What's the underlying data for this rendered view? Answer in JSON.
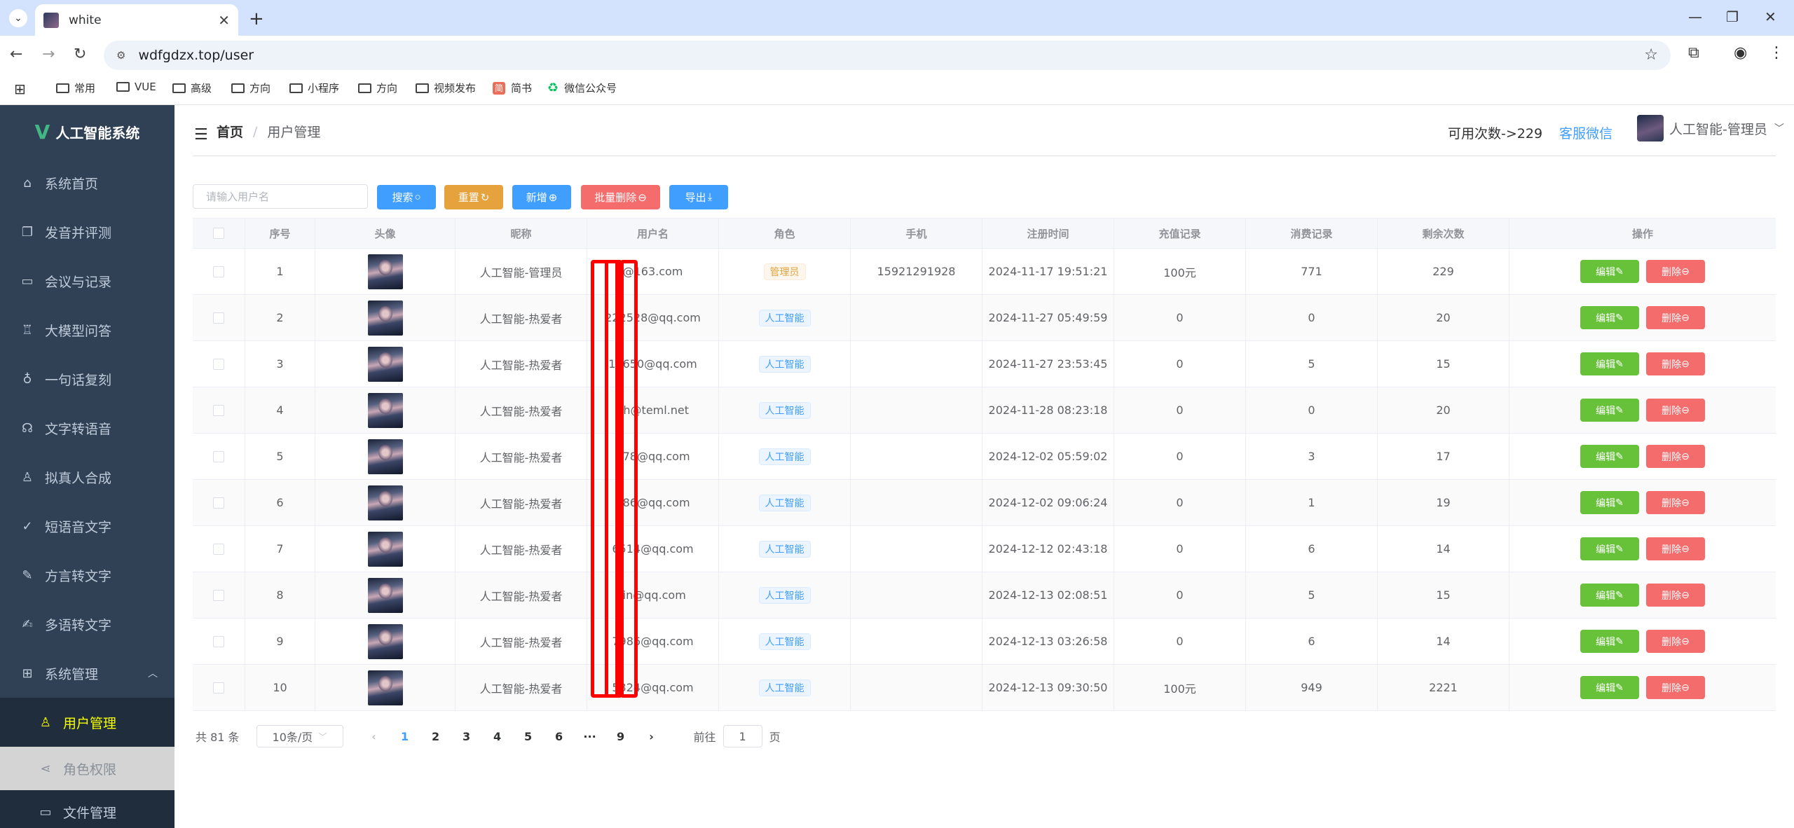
{
  "browser": {
    "tab_title": "white",
    "url": "wdfgdzx.top/user",
    "bookmarks": [
      "常用",
      "VUE",
      "高级",
      "方向",
      "小程序",
      "方向",
      "视频发布",
      "简书",
      "微信公众号"
    ]
  },
  "sidebar": {
    "logo": "人工智能系统",
    "items": [
      {
        "label": "系统首页",
        "icon": "home-icon"
      },
      {
        "label": "发音并评测",
        "icon": "book-icon"
      },
      {
        "label": "会议与记录",
        "icon": "monitor-icon"
      },
      {
        "label": "大模型问答",
        "icon": "cup-icon"
      },
      {
        "label": "一句话复刻",
        "icon": "microphone-icon"
      },
      {
        "label": "文字转语音",
        "icon": "headset-icon"
      },
      {
        "label": "拟真人合成",
        "icon": "user-icon"
      },
      {
        "label": "短语音文字",
        "icon": "sign-icon"
      },
      {
        "label": "方言转文字",
        "icon": "pen-icon"
      },
      {
        "label": "多语转文字",
        "icon": "edit-icon"
      },
      {
        "label": "系统管理",
        "icon": "menu-icon"
      }
    ],
    "sub_items": [
      {
        "label": "用户管理",
        "icon": "user-icon",
        "active": true
      },
      {
        "label": "角色权限",
        "icon": "share-icon"
      },
      {
        "label": "文件管理",
        "icon": "folder-icon"
      }
    ]
  },
  "header": {
    "breadcrumb_home": "首页",
    "breadcrumb_separator": "/",
    "breadcrumb_current": "用户管理",
    "available_count": "可用次数->229",
    "service_link": "客服微信",
    "user_name": "人工智能-管理员"
  },
  "toolbar": {
    "search_placeholder": "请输入用户名",
    "search_btn": "搜索",
    "reset_btn": "重置",
    "add_btn": "新增",
    "batch_delete_btn": "批量删除",
    "export_btn": "导出",
    "colors": {
      "primary": "#409eff",
      "warning": "#e6a23c",
      "danger": "#f56c6c",
      "success": "#67c23a"
    }
  },
  "table": {
    "columns": [
      "序号",
      "头像",
      "昵称",
      "用户名",
      "角色",
      "手机",
      "注册时间",
      "充值记录",
      "消费记录",
      "剩余次数",
      "操作"
    ],
    "edit_label": "编辑",
    "delete_label": "删除",
    "rows": [
      {
        "id": "1",
        "nickname": "人工智能-管理员",
        "username": "@163.com",
        "role": "管理员",
        "role_type": "admin",
        "phone": "15921291928",
        "reg_time": "2024-11-17 19:51:21",
        "recharge": "100元",
        "consume": "771",
        "remaining": "229"
      },
      {
        "id": "2",
        "nickname": "人工智能-热爱者",
        "username": "222528@qq.com",
        "role": "人工智能",
        "role_type": "ai",
        "phone": "",
        "reg_time": "2024-11-27 05:49:59",
        "recharge": "0",
        "consume": "0",
        "remaining": "20"
      },
      {
        "id": "3",
        "nickname": "人工智能-热爱者",
        "username": "17650@qq.com",
        "role": "人工智能",
        "role_type": "ai",
        "phone": "",
        "reg_time": "2024-11-27 23:53:45",
        "recharge": "0",
        "consume": "5",
        "remaining": "15"
      },
      {
        "id": "4",
        "nickname": "人工智能-热爱者",
        "username": "yh@teml.net",
        "role": "人工智能",
        "role_type": "ai",
        "phone": "",
        "reg_time": "2024-11-28 08:23:18",
        "recharge": "0",
        "consume": "0",
        "remaining": "20"
      },
      {
        "id": "5",
        "nickname": "人工智能-热爱者",
        "username": "978@qq.com",
        "role": "人工智能",
        "role_type": "ai",
        "phone": "",
        "reg_time": "2024-12-02 05:59:02",
        "recharge": "0",
        "consume": "3",
        "remaining": "17"
      },
      {
        "id": "6",
        "nickname": "人工智能-热爱者",
        "username": "986@qq.com",
        "role": "人工智能",
        "role_type": "ai",
        "phone": "",
        "reg_time": "2024-12-02 09:06:24",
        "recharge": "0",
        "consume": "1",
        "remaining": "19"
      },
      {
        "id": "7",
        "nickname": "人工智能-热爱者",
        "username": "6514@qq.com",
        "role": "人工智能",
        "role_type": "ai",
        "phone": "",
        "reg_time": "2024-12-12 02:43:18",
        "recharge": "0",
        "consume": "6",
        "remaining": "14"
      },
      {
        "id": "8",
        "nickname": "人工智能-热爱者",
        "username": "lin@qq.com",
        "role": "人工智能",
        "role_type": "ai",
        "phone": "",
        "reg_time": "2024-12-13 02:08:51",
        "recharge": "0",
        "consume": "5",
        "remaining": "15"
      },
      {
        "id": "9",
        "nickname": "人工智能-热爱者",
        "username": "7986@qq.com",
        "role": "人工智能",
        "role_type": "ai",
        "phone": "",
        "reg_time": "2024-12-13 03:26:58",
        "recharge": "0",
        "consume": "6",
        "remaining": "14"
      },
      {
        "id": "10",
        "nickname": "人工智能-热爱者",
        "username": "5324@qq.com",
        "role": "人工智能",
        "role_type": "ai",
        "phone": "",
        "reg_time": "2024-12-13 09:30:50",
        "recharge": "100元",
        "consume": "949",
        "remaining": "2221"
      }
    ]
  },
  "pagination": {
    "total": "共 81 条",
    "page_size": "10条/页",
    "pages": [
      "1",
      "2",
      "3",
      "4",
      "5",
      "6",
      "···",
      "9"
    ],
    "current": "1",
    "goto_prefix": "前往",
    "goto_value": "1",
    "goto_suffix": "页"
  }
}
